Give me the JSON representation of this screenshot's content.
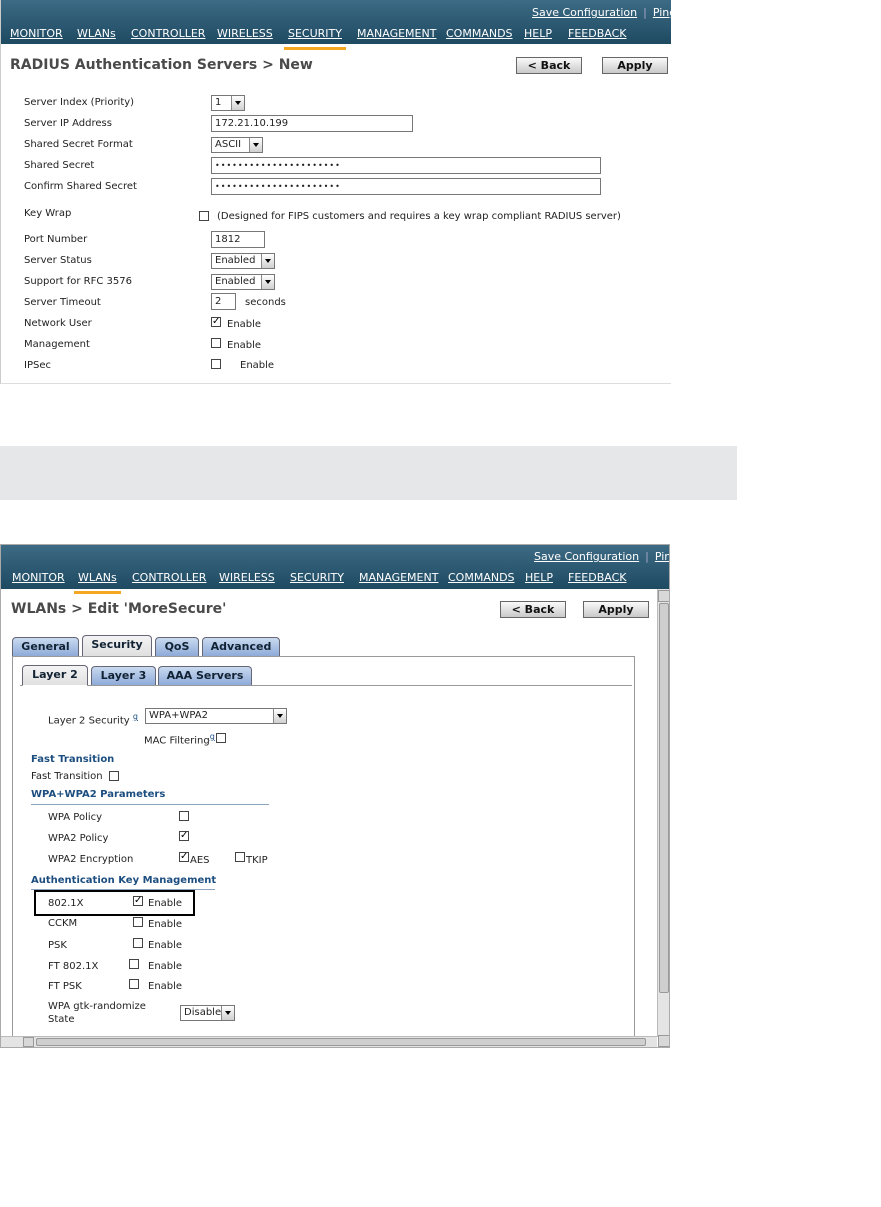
{
  "panel1": {
    "top_links": {
      "save": "Save Configuration",
      "sep": "|",
      "ping": "Ping"
    },
    "nav": [
      "MONITOR",
      "WLANs",
      "CONTROLLER",
      "WIRELESS",
      "SECURITY",
      "MANAGEMENT",
      "COMMANDS",
      "HELP",
      "FEEDBACK"
    ],
    "active_nav": "SECURITY",
    "title": "RADIUS Authentication Servers > New",
    "back": "< Back",
    "apply": "Apply",
    "fields": {
      "server_index_label": "Server Index (Priority)",
      "server_index_value": "1",
      "server_ip_label": "Server IP Address",
      "server_ip_value": "172.21.10.199",
      "secret_format_label": "Shared Secret Format",
      "secret_format_value": "ASCII",
      "secret_label": "Shared Secret",
      "secret_value": "••••••••••••••••••••••",
      "confirm_label": "Confirm Shared Secret",
      "confirm_value": "••••••••••••••••••••••",
      "keywrap_label": "Key Wrap",
      "keywrap_note": "(Designed for FIPS customers and requires a key wrap compliant RADIUS server)",
      "port_label": "Port Number",
      "port_value": "1812",
      "status_label": "Server Status",
      "status_value": "Enabled",
      "rfc_label": "Support for RFC 3576",
      "rfc_value": "Enabled",
      "timeout_label": "Server Timeout",
      "timeout_value": "2",
      "timeout_unit": "seconds",
      "netuser_label": "Network User",
      "netuser_enable": "Enable",
      "mgmt_label": "Management",
      "mgmt_enable": "Enable",
      "ipsec_label": "IPSec",
      "ipsec_enable": "Enable"
    }
  },
  "panel2": {
    "top_links": {
      "save": "Save Configuration",
      "sep": "|",
      "ping": "Ping"
    },
    "nav": [
      "MONITOR",
      "WLANs",
      "CONTROLLER",
      "WIRELESS",
      "SECURITY",
      "MANAGEMENT",
      "COMMANDS",
      "HELP",
      "FEEDBACK"
    ],
    "active_nav": "WLANs",
    "title": "WLANs > Edit  'MoreSecure'",
    "back": "< Back",
    "apply": "Apply",
    "tabs": [
      "General",
      "Security",
      "QoS",
      "Advanced"
    ],
    "active_tab": "Security",
    "subtabs": [
      "Layer 2",
      "Layer 3",
      "AAA Servers"
    ],
    "active_subtab": "Layer 2",
    "l2_security_label": "Layer 2 Security",
    "help_mark": "g",
    "l2_security_value": "WPA+WPA2",
    "mac_filtering_label": "MAC Filtering",
    "fast_transition_heading": "Fast Transition",
    "fast_transition_label": "Fast Transition",
    "wpa_params_heading": "WPA+WPA2 Parameters",
    "wpa_policy_label": "WPA Policy",
    "wpa2_policy_label": "WPA2 Policy",
    "wpa2_enc_label": "WPA2 Encryption",
    "aes_label": "AES",
    "tkip_label": "TKIP",
    "akm_heading": "Authentication Key Management",
    "akm_rows": [
      {
        "label": "802.1X",
        "checked": true,
        "enable": "Enable"
      },
      {
        "label": "CCKM",
        "checked": false,
        "enable": "Enable"
      },
      {
        "label": "PSK",
        "checked": false,
        "enable": "Enable"
      },
      {
        "label": "FT 802.1X",
        "checked": false,
        "enable": "Enable"
      },
      {
        "label": "FT PSK",
        "checked": false,
        "enable": "Enable"
      }
    ],
    "gtk_label_1": "WPA gtk-randomize",
    "gtk_label_2": "State",
    "gtk_value": "Disable"
  },
  "colors": {
    "nav_bg": "#2a5670",
    "active_underline": "#f5a623",
    "tab_blue": "#9fb8e0",
    "section_text": "#1c4e80"
  }
}
